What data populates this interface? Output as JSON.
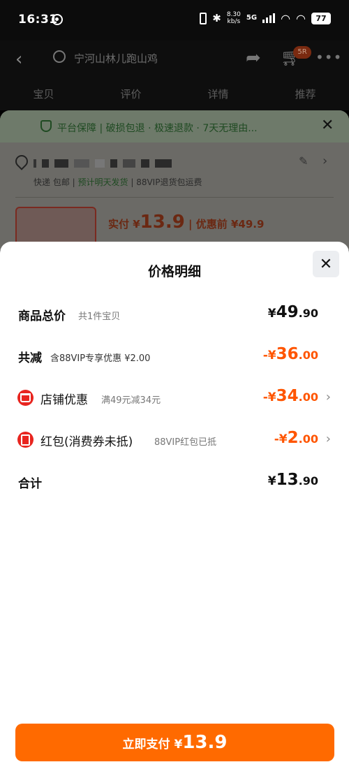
{
  "status_bar": {
    "time": "16:31",
    "net_speed_value": "8.30",
    "net_speed_unit": "kb/s",
    "signal": "5G",
    "battery": "77",
    "icons": [
      "netease-music-icon",
      "vibrate-icon",
      "bluetooth-icon",
      "signal-icon",
      "wifi-icon",
      "battery-icon"
    ]
  },
  "background": {
    "search_text": "宁河山林儿跑山鸡",
    "cart_badge": "5R",
    "tabs": [
      "宝贝",
      "评价",
      "详情",
      "推荐"
    ],
    "guarantee_text": "平台保障 | 破损包退 · 极速退款 · 7天无理由...",
    "shipping_prefix": "快递 包邮 | ",
    "shipping_highlight": "预计明天发货",
    "shipping_suffix": " | 88VIP退货包运费",
    "actual_pay_label": "实付 ¥",
    "actual_pay_value": "13.9",
    "before_discount": " | 优惠前 ¥49.9"
  },
  "modal": {
    "title": "价格明细",
    "rows": {
      "total": {
        "label": "商品总价",
        "sub": "共1件宝贝",
        "currency": "¥",
        "price_integer": "49",
        "price_decimal": ".90"
      },
      "discount": {
        "label": "共减",
        "sub": "含88VIP专享优惠 ¥2.00",
        "prefix": "-¥",
        "price_integer": "36",
        "price_decimal": ".00"
      },
      "shop": {
        "label": "店铺优惠",
        "sub": "满49元减34元",
        "prefix": "-¥",
        "price_integer": "34",
        "price_decimal": ".00"
      },
      "red_packet": {
        "label": "红包(消费券未抵)",
        "sub": "88VIP红包已抵",
        "prefix": "-¥",
        "price_integer": "2",
        "price_decimal": ".00"
      },
      "sum": {
        "label": "合计",
        "currency": "¥",
        "price_integer": "13",
        "price_decimal": ".90"
      }
    },
    "pay_button": {
      "label": "立即支付",
      "currency": "¥",
      "amount": "13.9"
    }
  },
  "colors": {
    "accent_orange": "#ff5500",
    "button_orange": "#ff6a00",
    "icon_red": "#e8251f"
  }
}
